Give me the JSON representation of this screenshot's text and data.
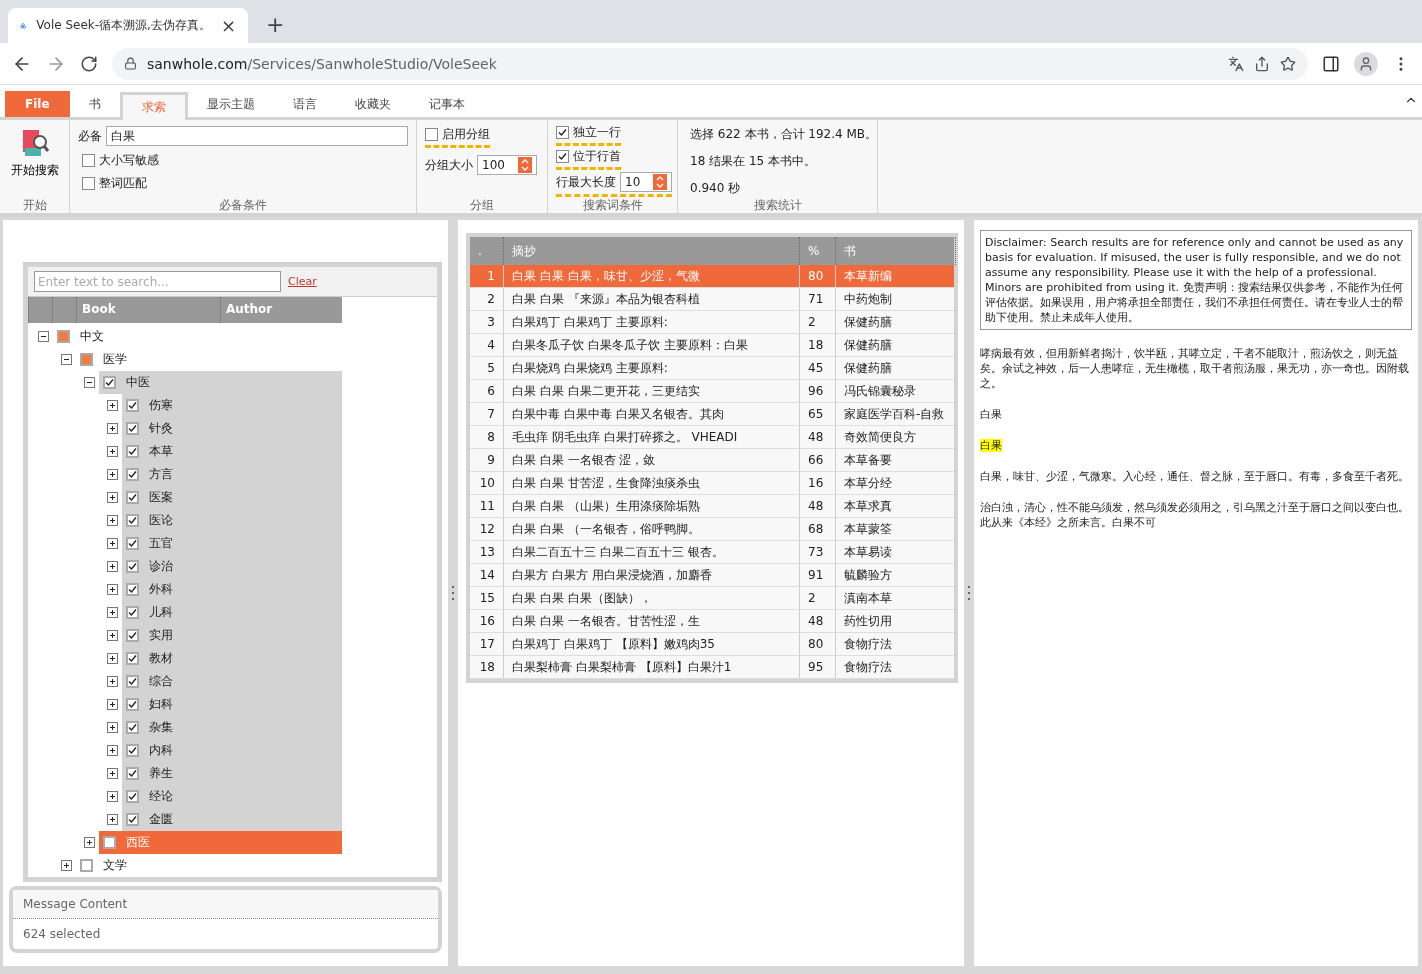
{
  "browser": {
    "tab_title": "Vole Seek-循本溯源,去伪存真。",
    "new_tab": "+",
    "close": "×",
    "url_host": "sanwhole.com",
    "url_path": "/Services/SanwholeStudio/VoleSeek"
  },
  "ribbon_tabs": [
    {
      "label": "File",
      "kind": "file",
      "selected": false
    },
    {
      "label": "书",
      "kind": "tab",
      "selected": false
    },
    {
      "label": "求索",
      "kind": "tab",
      "selected": true
    },
    {
      "label": "显示主题",
      "kind": "tab",
      "selected": false
    },
    {
      "label": "语言",
      "kind": "tab",
      "selected": false
    },
    {
      "label": "收藏夹",
      "kind": "tab",
      "selected": false
    },
    {
      "label": "记事本",
      "kind": "tab",
      "selected": false
    }
  ],
  "ribbon": {
    "start": {
      "button": "开始搜索",
      "caption": "开始"
    },
    "required": {
      "label": "必备",
      "value": "白果",
      "options": [
        {
          "label": "大小写敏感",
          "checked": false
        },
        {
          "label": "整词匹配",
          "checked": false
        }
      ],
      "caption": "必备条件"
    },
    "grouping": {
      "option": {
        "label": "启用分组",
        "checked": false
      },
      "size_label": "分组大小",
      "size_value": "100",
      "caption": "分组"
    },
    "term": {
      "options": [
        {
          "label": "独立一行",
          "checked": true
        },
        {
          "label": "位于行首",
          "checked": true
        }
      ],
      "max_label": "行最大长度",
      "max_value": "10",
      "caption": "搜索词条件"
    },
    "stats": {
      "lines": [
        "选择 622 本书，合计 192.4 MB。",
        "18 结果在 15 本书中。",
        "0.940 秒"
      ],
      "caption": "搜索统计"
    }
  },
  "book_panel": {
    "search_placeholder": "Enter text to search...",
    "clear": "Clear",
    "columns": [
      "Book",
      "Author"
    ],
    "tree": [
      {
        "label": "中文",
        "checked": false,
        "partial": true,
        "expanded": true,
        "selected": false,
        "children": [
          {
            "label": "医学",
            "checked": false,
            "partial": true,
            "expanded": true,
            "selected": false,
            "children": [
              {
                "label": "中医",
                "checked": true,
                "partial": false,
                "expanded": true,
                "selected": false,
                "children": [
                  {
                    "label": "伤寒",
                    "checked": true,
                    "partial": false,
                    "expanded": false,
                    "selected": false
                  },
                  {
                    "label": "针灸",
                    "checked": true,
                    "partial": false,
                    "expanded": false,
                    "selected": false
                  },
                  {
                    "label": "本草",
                    "checked": true,
                    "partial": false,
                    "expanded": false,
                    "selected": false
                  },
                  {
                    "label": "方言",
                    "checked": true,
                    "partial": false,
                    "expanded": false,
                    "selected": false
                  },
                  {
                    "label": "医案",
                    "checked": true,
                    "partial": false,
                    "expanded": false,
                    "selected": false
                  },
                  {
                    "label": "医论",
                    "checked": true,
                    "partial": false,
                    "expanded": false,
                    "selected": false
                  },
                  {
                    "label": "五官",
                    "checked": true,
                    "partial": false,
                    "expanded": false,
                    "selected": false
                  },
                  {
                    "label": "诊治",
                    "checked": true,
                    "partial": false,
                    "expanded": false,
                    "selected": false
                  },
                  {
                    "label": "外科",
                    "checked": true,
                    "partial": false,
                    "expanded": false,
                    "selected": false
                  },
                  {
                    "label": "儿科",
                    "checked": true,
                    "partial": false,
                    "expanded": false,
                    "selected": false
                  },
                  {
                    "label": "实用",
                    "checked": true,
                    "partial": false,
                    "expanded": false,
                    "selected": false
                  },
                  {
                    "label": "教材",
                    "checked": true,
                    "partial": false,
                    "expanded": false,
                    "selected": false
                  },
                  {
                    "label": "综合",
                    "checked": true,
                    "partial": false,
                    "expanded": false,
                    "selected": false
                  },
                  {
                    "label": "妇科",
                    "checked": true,
                    "partial": false,
                    "expanded": false,
                    "selected": false
                  },
                  {
                    "label": "杂集",
                    "checked": true,
                    "partial": false,
                    "expanded": false,
                    "selected": false
                  },
                  {
                    "label": "内科",
                    "checked": true,
                    "partial": false,
                    "expanded": false,
                    "selected": false
                  },
                  {
                    "label": "养生",
                    "checked": true,
                    "partial": false,
                    "expanded": false,
                    "selected": false
                  },
                  {
                    "label": "经论",
                    "checked": true,
                    "partial": false,
                    "expanded": false,
                    "selected": false
                  },
                  {
                    "label": "金匮",
                    "checked": true,
                    "partial": false,
                    "expanded": false,
                    "selected": false
                  }
                ]
              },
              {
                "label": "西医",
                "checked": false,
                "partial": false,
                "expanded": false,
                "selected": true
              }
            ]
          },
          {
            "label": "文学",
            "checked": false,
            "partial": false,
            "expanded": false,
            "selected": false
          }
        ]
      }
    ]
  },
  "message": {
    "title": "Message Content",
    "text": "624 selected"
  },
  "results": {
    "columns": [
      ".",
      "摘抄",
      "%",
      "书"
    ],
    "rows": [
      {
        "no": "1",
        "excerpt": "白果 白果 白果，味甘、少涩，气微",
        "pct": "80",
        "book": "本草新编",
        "selected": true
      },
      {
        "no": "2",
        "excerpt": "白果 白果 『来源』本品为银杏科植",
        "pct": "71",
        "book": "中药炮制",
        "selected": false
      },
      {
        "no": "3",
        "excerpt": "白果鸡丁 白果鸡丁 主要原料:",
        "pct": "2",
        "book": "保健药膳",
        "selected": false
      },
      {
        "no": "4",
        "excerpt": "白果冬瓜子饮 白果冬瓜子饮 主要原料：白果",
        "pct": "18",
        "book": "保健药膳",
        "selected": false
      },
      {
        "no": "5",
        "excerpt": "白果烧鸡 白果烧鸡 主要原料:",
        "pct": "45",
        "book": "保健药膳",
        "selected": false
      },
      {
        "no": "6",
        "excerpt": "白果 白果 白果二更开花，三更结实",
        "pct": "96",
        "book": "冯氏锦囊秘录",
        "selected": false
      },
      {
        "no": "7",
        "excerpt": "白果中毒 白果中毒 白果又名银杏。其肉",
        "pct": "65",
        "book": "家庭医学百科-自救",
        "selected": false
      },
      {
        "no": "8",
        "excerpt": "毛虫痒 阴毛虫痒 白果打碎搽之。 VHEADI",
        "pct": "48",
        "book": "奇效简便良方",
        "selected": false
      },
      {
        "no": "9",
        "excerpt": "白果 白果 一名银杏 涩，敛",
        "pct": "66",
        "book": "本草备要",
        "selected": false
      },
      {
        "no": "10",
        "excerpt": "白果 白果 甘苦涩，生食降浊痰杀虫",
        "pct": "16",
        "book": "本草分经",
        "selected": false
      },
      {
        "no": "11",
        "excerpt": "白果 白果 （山果）生用涤痰除垢熟",
        "pct": "48",
        "book": "本草求真",
        "selected": false
      },
      {
        "no": "12",
        "excerpt": "白果 白果 （一名银杏，俗呼鸭脚。",
        "pct": "68",
        "book": "本草蒙筌",
        "selected": false
      },
      {
        "no": "13",
        "excerpt": "白果二百五十三 白果二百五十三 银杏。",
        "pct": "73",
        "book": "本草易读",
        "selected": false
      },
      {
        "no": "14",
        "excerpt": "白果方 白果方 用白果浸烧酒，加麝香",
        "pct": "91",
        "book": "毓麟验方",
        "selected": false
      },
      {
        "no": "15",
        "excerpt": "白果 白果 白果（图缺），",
        "pct": "2",
        "book": "滇南本草",
        "selected": false
      },
      {
        "no": "16",
        "excerpt": "白果 白果 一名银杏。甘苦性涩，生",
        "pct": "48",
        "book": "药性切用",
        "selected": false
      },
      {
        "no": "17",
        "excerpt": "白果鸡丁 白果鸡丁 【原料】嫩鸡肉35",
        "pct": "80",
        "book": "食物疗法",
        "selected": false
      },
      {
        "no": "18",
        "excerpt": "白果梨柿膏 白果梨柿膏 【原料】白果汁1",
        "pct": "95",
        "book": "食物疗法",
        "selected": false
      }
    ]
  },
  "detail": {
    "disclaimer": "Disclaimer: Search results are for reference only and cannot be used as any basis for evaluation. If misused, the user is fully responsible, and we do not assume any responsibility. Please use it with the help of a professional. Minors are prohibited from using it. 免责声明：搜索结果仅供参考，不能作为任何评估依据。如果误用，用户将承担全部责任，我们不承担任何责任。请在专业人士的帮助下使用。禁止未成年人使用。",
    "paragraphs": [
      {
        "kind": "text",
        "text": "哮病最有效，但用新鲜者捣汁，饮半瓯，其哮立定，干者不能取汁，煎汤饮之，则无益矣。余试之神效，后一人患哮症，无生橄榄，取干者煎汤服，果无功，亦一奇也。因附载之。"
      },
      {
        "kind": "text",
        "text": "白果"
      },
      {
        "kind": "highlight",
        "text": "白果"
      },
      {
        "kind": "text",
        "text": "白果，味甘、少涩，气微寒。入心经，通任、督之脉，至于唇口。有毒，多食至千者死。"
      },
      {
        "kind": "text",
        "text": "治白浊，清心，性不能乌须发，然乌须发必须用之，引乌黑之汁至于唇口之间以变白也。此从来《本经》之所未言。白果不可"
      }
    ]
  }
}
